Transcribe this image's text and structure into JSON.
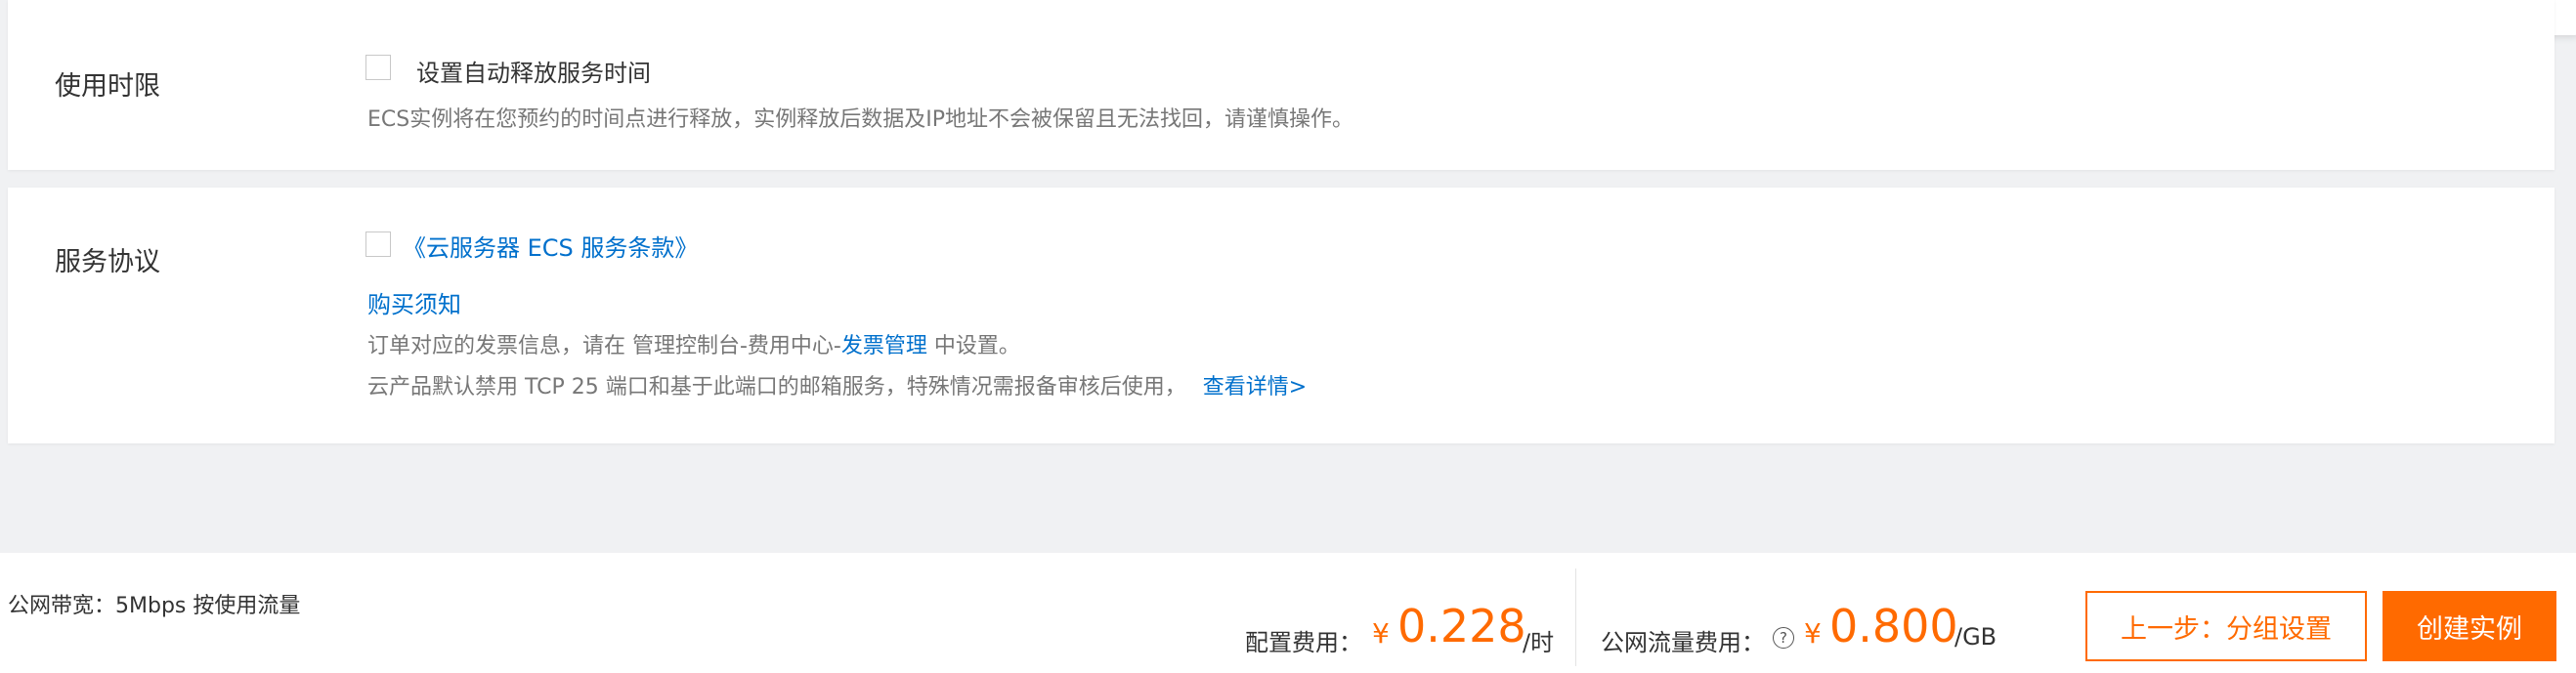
{
  "usage_section": {
    "label": "使用时限",
    "checkbox_label": "设置自动释放服务时间",
    "checked": false,
    "description": "ECS实例将在您预约的时间点进行释放，实例释放后数据及IP地址不会被保留且无法找回，请谨慎操作。"
  },
  "agreement_section": {
    "label": "服务协议",
    "checkbox_link": "《云服务器 ECS 服务条款》",
    "checked": false,
    "purchase_notice": "购买须知",
    "invoice_prefix": "订单对应的发票信息，请在 管理控制台-费用中心-",
    "invoice_link": "发票管理",
    "invoice_suffix": " 中设置。",
    "tcp_notice": "云产品默认禁用 TCP 25 端口和基于此端口的邮箱服务，特殊情况需报备审核后使用，",
    "details_link": "查看详情>"
  },
  "bottom_bar": {
    "bandwidth_label": "公网带宽：",
    "bandwidth_value": "5Mbps 按使用流量",
    "config_fee_label": "配置费用：",
    "config_fee_currency": "¥",
    "config_fee_value": "0.228",
    "config_fee_unit": "/时",
    "traffic_fee_label": "公网流量费用：",
    "traffic_help_symbol": "?",
    "traffic_fee_currency": "¥",
    "traffic_fee_value": "0.800",
    "traffic_fee_unit": "/GB",
    "prev_button": "上一步：分组设置",
    "create_button": "创建实例"
  },
  "colors": {
    "accent": "#ff6a00",
    "link": "#0070cc"
  }
}
